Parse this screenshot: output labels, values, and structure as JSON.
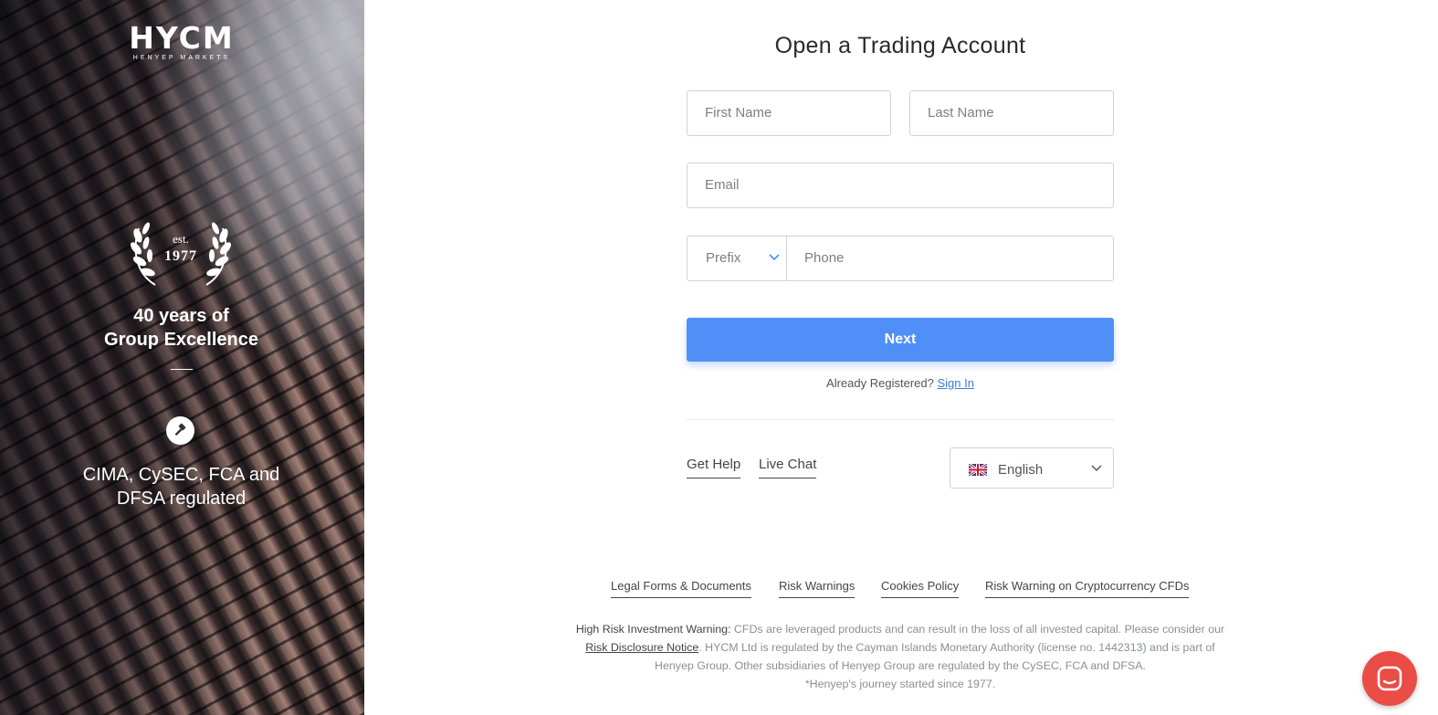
{
  "brand": {
    "logo_text": "HYCM",
    "logo_subtext": "HENYEP MARKETS"
  },
  "left_panel": {
    "est_word": "est.",
    "est_year": "1977",
    "years_line1": "40 years of",
    "years_line2": "Group Excellence",
    "regulated_line1": "CIMA, CySEC, FCA and",
    "regulated_line2": "DFSA regulated"
  },
  "form": {
    "title": "Open a Trading Account",
    "first_name_placeholder": "First Name",
    "last_name_placeholder": "Last Name",
    "email_placeholder": "Email",
    "prefix_label": "Prefix",
    "phone_placeholder": "Phone",
    "next_label": "Next",
    "already_registered": "Already Registered?",
    "sign_in": "Sign In"
  },
  "help": {
    "get_help": "Get Help",
    "live_chat": "Live Chat"
  },
  "language": {
    "selected": "English",
    "flag_icon": "uk-flag-icon"
  },
  "footer": {
    "links": [
      "Legal Forms & Documents",
      "Risk Warnings",
      "Cookies Policy",
      "Risk Warning on Cryptocurrency CFDs"
    ],
    "warning_title": "High Risk Investment Warning:",
    "warning_text_1": " CFDs are leveraged products and can result in the loss of all invested capital. Please consider our",
    "risk_notice": "Risk Disclosure Notice",
    "warning_text_2": ". HYCM Ltd is regulated by the Cayman Islands Monetary Authority (license no. 1442313) and is part of",
    "warning_text_3": "Henyep Group. Other subsidiaries of Henyep Group are regulated by the CySEC, FCA and DFSA.",
    "journey_note": "*Henyep's journey started since 1977."
  },
  "colors": {
    "primary": "#4f8ff7",
    "chat": "#ea4c46",
    "link": "#3a7bdc"
  }
}
